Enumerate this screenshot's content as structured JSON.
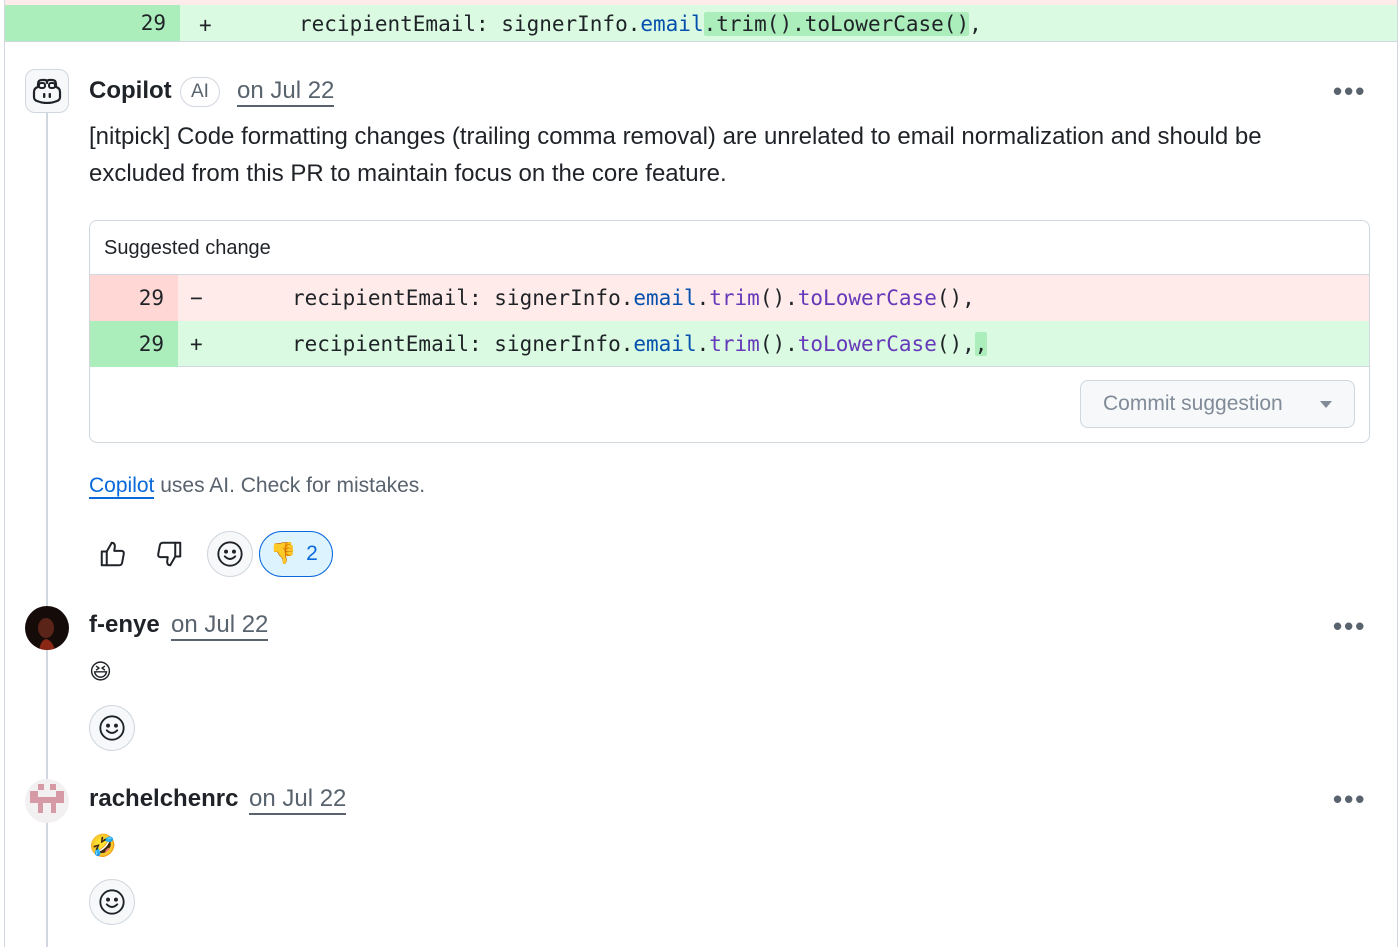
{
  "top_diff": {
    "line_number": "29",
    "sign": "+",
    "code_indent": "",
    "code_prefix": "recipientEmail: signerInfo.",
    "code_prop": "email",
    "code_hl": ".trim().toLowerCase()",
    "code_suffix": ","
  },
  "comments": [
    {
      "author": "Copilot",
      "badge": "AI",
      "date": "on Jul 22",
      "more": "•••",
      "body": "[nitpick] Code formatting changes (trailing comma removal) are unrelated to email normalization and should be excluded from this PR to maintain focus on the core feature.",
      "suggestion": {
        "header": "Suggested change",
        "del": {
          "line_number": "29",
          "sign": "−",
          "prefix": "recipientEmail: signerInfo.",
          "prop": "email",
          "dot1": ".",
          "fn1": "trim",
          "mid": "().",
          "fn2": "toLowerCase",
          "end": "(),"
        },
        "add": {
          "line_number": "29",
          "sign": "+",
          "prefix": "recipientEmail: signerInfo.",
          "prop": "email",
          "dot1": ".",
          "fn1": "trim",
          "mid": "().",
          "fn2": "toLowerCase",
          "end": "(),",
          "hl": ","
        },
        "commit_label": "Commit suggestion"
      },
      "disclaimer_link": "Copilot",
      "disclaimer_text": " uses AI. Check for mistakes.",
      "reaction": {
        "emoji": "👎",
        "count": "2"
      }
    },
    {
      "author": "f-enye",
      "date": "on Jul 22",
      "more": "•••",
      "body_emoji": "😆"
    },
    {
      "author": "rachelchenrc",
      "date": "on Jul 22",
      "more": "•••",
      "body_emoji": "🤣"
    }
  ],
  "colors": {
    "add_bg": "#dafbe1",
    "add_num_bg": "#aceebb",
    "del_bg": "#ffebe9",
    "link": "#0969da",
    "muted": "#59636e"
  },
  "icons": [
    "copilot-icon",
    "thumbs-up-icon",
    "thumbs-down-icon",
    "smiley-icon",
    "kebab-icon"
  ]
}
